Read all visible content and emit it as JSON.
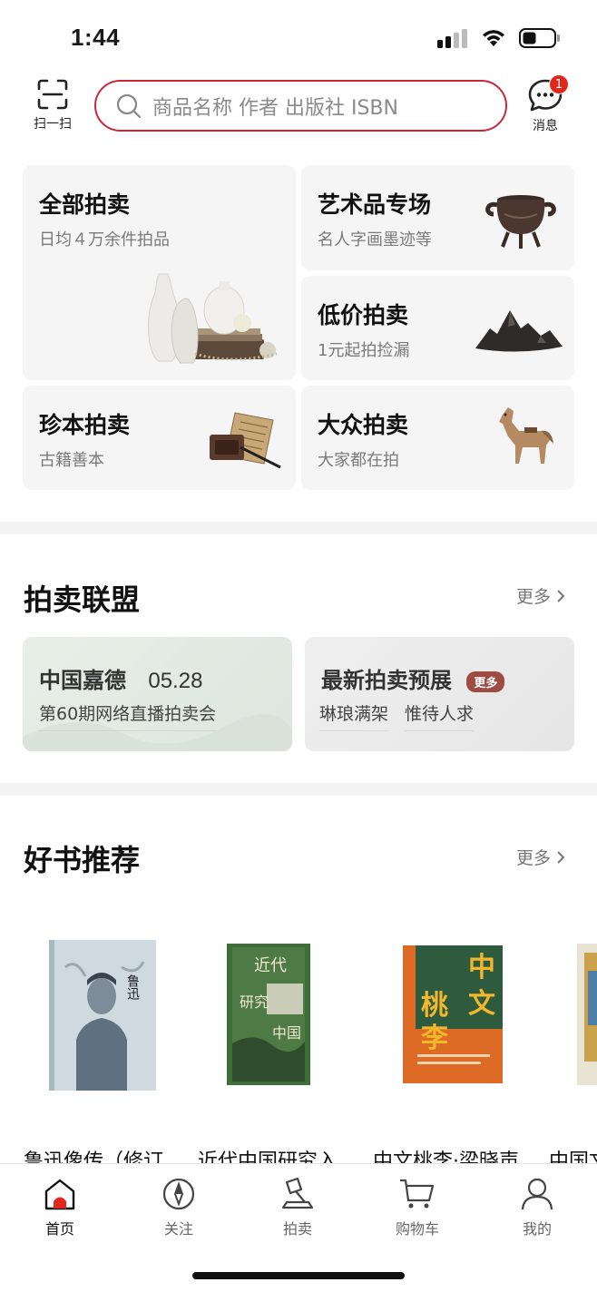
{
  "status_bar": {
    "time": "1:44"
  },
  "header": {
    "scan_label": "扫一扫",
    "search_placeholder": "商品名称 作者 出版社 ISBN",
    "message_label": "消息",
    "message_badge": "1",
    "accent_color": "#c8283a"
  },
  "categories": [
    {
      "title": "全部拍卖",
      "subtitle": "日均４万余件拍品",
      "icon": "vases-still-life-image"
    },
    {
      "title": "艺术品专场",
      "subtitle": "名人字画墨迹等",
      "icon": "bronze-censer-image"
    },
    {
      "title": "低价拍卖",
      "subtitle": "1元起拍捡漏",
      "icon": "mountain-rock-image"
    },
    {
      "title": "珍本拍卖",
      "subtitle": "古籍善本",
      "icon": "ancient-scroll-image"
    },
    {
      "title": "大众拍卖",
      "subtitle": "大家都在拍",
      "icon": "tang-horse-image"
    }
  ],
  "alliance": {
    "title": "拍卖联盟",
    "more": "更多",
    "cards": [
      {
        "name": "中国嘉德",
        "date": "05.28",
        "desc": "第60期网络直播拍卖会"
      },
      {
        "name": "最新拍卖预展",
        "tag": "更多",
        "desc1": "琳琅满架",
        "desc2": "惟待人求"
      }
    ]
  },
  "books_section": {
    "title": "好书推荐",
    "more": "更多",
    "books": [
      {
        "title": "鲁迅像传（修订"
      },
      {
        "title": "近代中国研究入"
      },
      {
        "title": "中文桃李·梁晓声"
      },
      {
        "title": "中国文"
      }
    ]
  },
  "tabbar": [
    {
      "label": "首页",
      "icon": "home-icon",
      "active": true
    },
    {
      "label": "关注",
      "icon": "compass-icon"
    },
    {
      "label": "拍卖",
      "icon": "gavel-icon"
    },
    {
      "label": "购物车",
      "icon": "cart-icon"
    },
    {
      "label": "我的",
      "icon": "user-icon"
    }
  ]
}
